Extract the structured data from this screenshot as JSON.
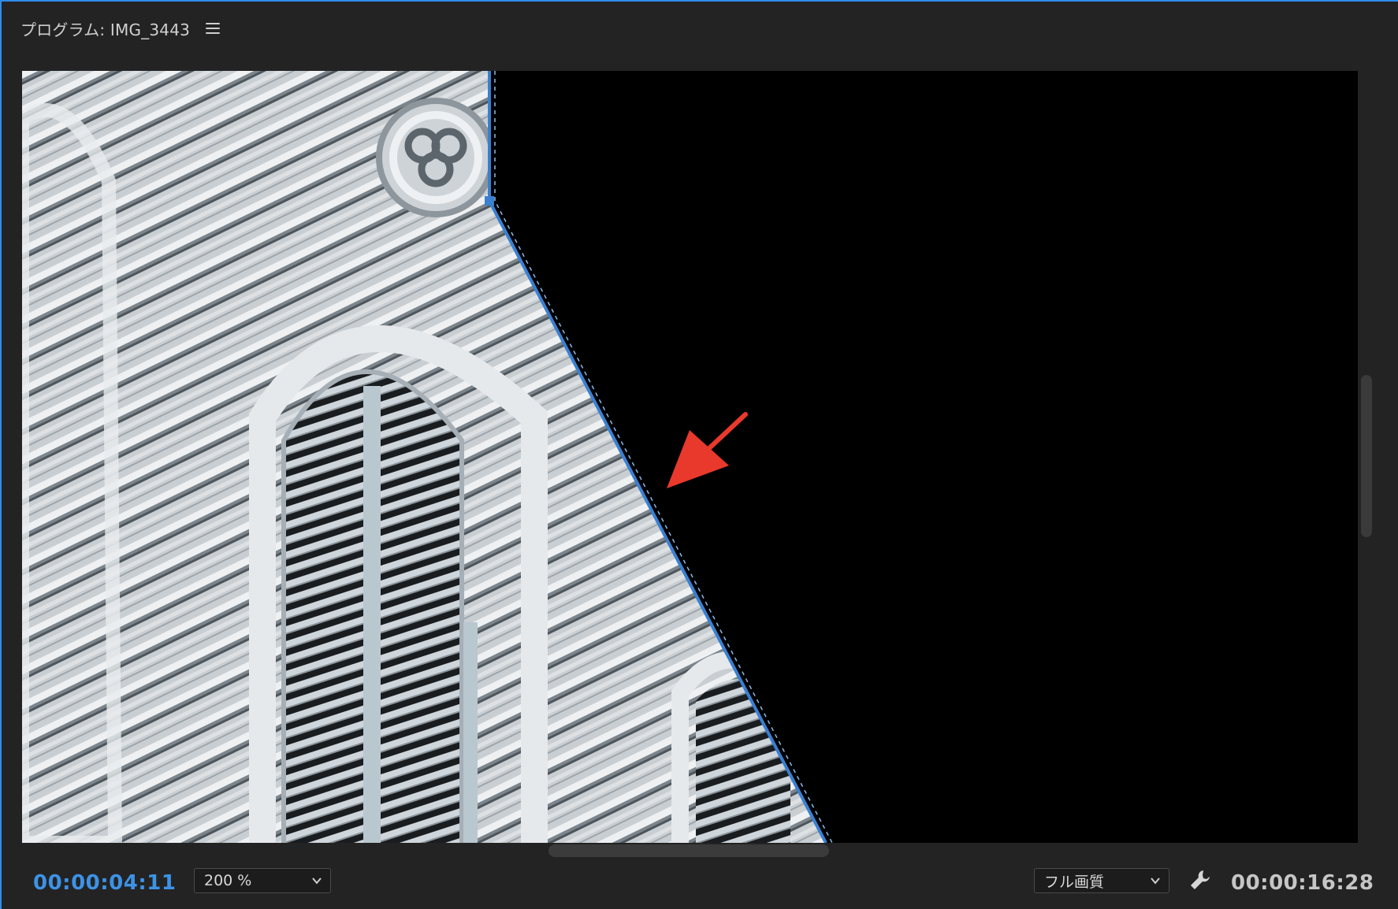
{
  "panel": {
    "title": "プログラム: IMG_3443"
  },
  "icons": {
    "menu": "hamburger-menu-icon",
    "wrench": "wrench-icon",
    "dropdown": "chevron-down-icon",
    "annotation": "red-arrow-icon"
  },
  "footer": {
    "current_timecode": "00:00:04:11",
    "zoom_value": "200 %",
    "quality_value": "フル画質",
    "duration_timecode": "00:00:16:28"
  },
  "colors": {
    "accent": "#2d8ceb",
    "timecode_blue": "#3d92e6",
    "mask_path": "#3a7fd0",
    "annotation_arrow": "#e8392c"
  }
}
